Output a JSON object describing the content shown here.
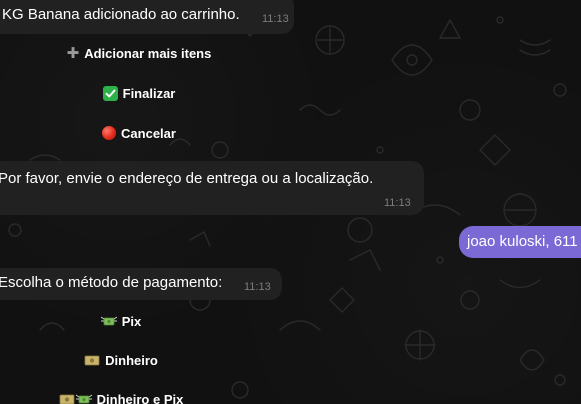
{
  "messages": {
    "added": {
      "text": "KG Banana adicionado ao carrinho.",
      "time": "11:13",
      "buttons": {
        "add_more": "Adicionar mais itens",
        "finish": "Finalizar",
        "cancel": "Cancelar"
      }
    },
    "address_request": {
      "text": "Por favor, envie o endereço de entrega ou a localização.",
      "time": "11:13"
    },
    "user_reply": {
      "text": "joao kuloski, 611"
    },
    "payment": {
      "text": "Escolha o método de pagamento:",
      "time": "11:13",
      "buttons": {
        "pix": "Pix",
        "cash": "Dinheiro",
        "cash_pix": "Dinheiro e Pix"
      }
    }
  },
  "colors": {
    "background": "#111111",
    "incoming_bubble": "#212121",
    "outgoing_bubble": "#7b6ad6",
    "timestamp": "#7c7c7c"
  },
  "icons": {
    "add_more": "plus-icon",
    "finish": "check-box-icon",
    "cancel": "red-circle-icon",
    "pix": "money-with-wings-icon",
    "cash": "banknote-icon",
    "cash_pix": "banknote-and-money-with-wings-icon"
  }
}
